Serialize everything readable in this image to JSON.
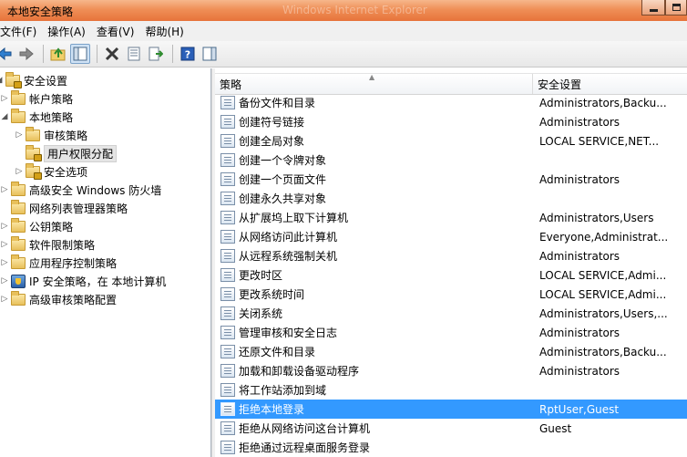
{
  "window": {
    "title": "本地安全策略",
    "faint_title": "Windows Internet Explorer"
  },
  "menu": [
    "文件(F)",
    "操作(A)",
    "查看(V)",
    "帮助(H)"
  ],
  "tree": [
    {
      "label": "安全设置",
      "level": 0,
      "expander": "down",
      "icon": "lock-folder"
    },
    {
      "label": "帐户策略",
      "level": 1,
      "expander": "right",
      "icon": "folder"
    },
    {
      "label": "本地策略",
      "level": 1,
      "expander": "down",
      "icon": "folder"
    },
    {
      "label": "审核策略",
      "level": 2,
      "expander": "right",
      "icon": "folder"
    },
    {
      "label": "用户权限分配",
      "level": 2,
      "expander": "none",
      "icon": "lock-folder",
      "selected": true
    },
    {
      "label": "安全选项",
      "level": 2,
      "expander": "right",
      "icon": "lock-folder"
    },
    {
      "label": "高级安全 Windows 防火墙",
      "level": 1,
      "expander": "right",
      "icon": "folder"
    },
    {
      "label": "网络列表管理器策略",
      "level": 1,
      "expander": "none",
      "icon": "folder"
    },
    {
      "label": "公钥策略",
      "level": 1,
      "expander": "right",
      "icon": "folder"
    },
    {
      "label": "软件限制策略",
      "level": 1,
      "expander": "right",
      "icon": "folder"
    },
    {
      "label": "应用程序控制策略",
      "level": 1,
      "expander": "right",
      "icon": "folder"
    },
    {
      "label": "IP 安全策略，在 本地计算机",
      "level": 1,
      "expander": "right",
      "icon": "shield"
    },
    {
      "label": "高级审核策略配置",
      "level": 1,
      "expander": "right",
      "icon": "folder"
    }
  ],
  "list": {
    "columns": [
      "策略",
      "安全设置"
    ],
    "rows": [
      {
        "policy": "备份文件和目录",
        "setting": "Administrators,Backu..."
      },
      {
        "policy": "创建符号链接",
        "setting": "Administrators"
      },
      {
        "policy": "创建全局对象",
        "setting": "LOCAL SERVICE,NET..."
      },
      {
        "policy": "创建一个令牌对象",
        "setting": ""
      },
      {
        "policy": "创建一个页面文件",
        "setting": "Administrators"
      },
      {
        "policy": "创建永久共享对象",
        "setting": ""
      },
      {
        "policy": "从扩展坞上取下计算机",
        "setting": "Administrators,Users"
      },
      {
        "policy": "从网络访问此计算机",
        "setting": "Everyone,Administrat..."
      },
      {
        "policy": "从远程系统强制关机",
        "setting": "Administrators"
      },
      {
        "policy": "更改时区",
        "setting": "LOCAL SERVICE,Admi..."
      },
      {
        "policy": "更改系统时间",
        "setting": "LOCAL SERVICE,Admi..."
      },
      {
        "policy": "关闭系统",
        "setting": "Administrators,Users,..."
      },
      {
        "policy": "管理审核和安全日志",
        "setting": "Administrators"
      },
      {
        "policy": "还原文件和目录",
        "setting": "Administrators,Backu..."
      },
      {
        "policy": "加载和卸载设备驱动程序",
        "setting": "Administrators"
      },
      {
        "policy": "将工作站添加到域",
        "setting": ""
      },
      {
        "policy": "拒绝本地登录",
        "setting": "RptUser,Guest",
        "selected": true
      },
      {
        "policy": "拒绝从网络访问这台计算机",
        "setting": "Guest"
      },
      {
        "policy": "拒绝通过远程桌面服务登录",
        "setting": ""
      }
    ]
  }
}
